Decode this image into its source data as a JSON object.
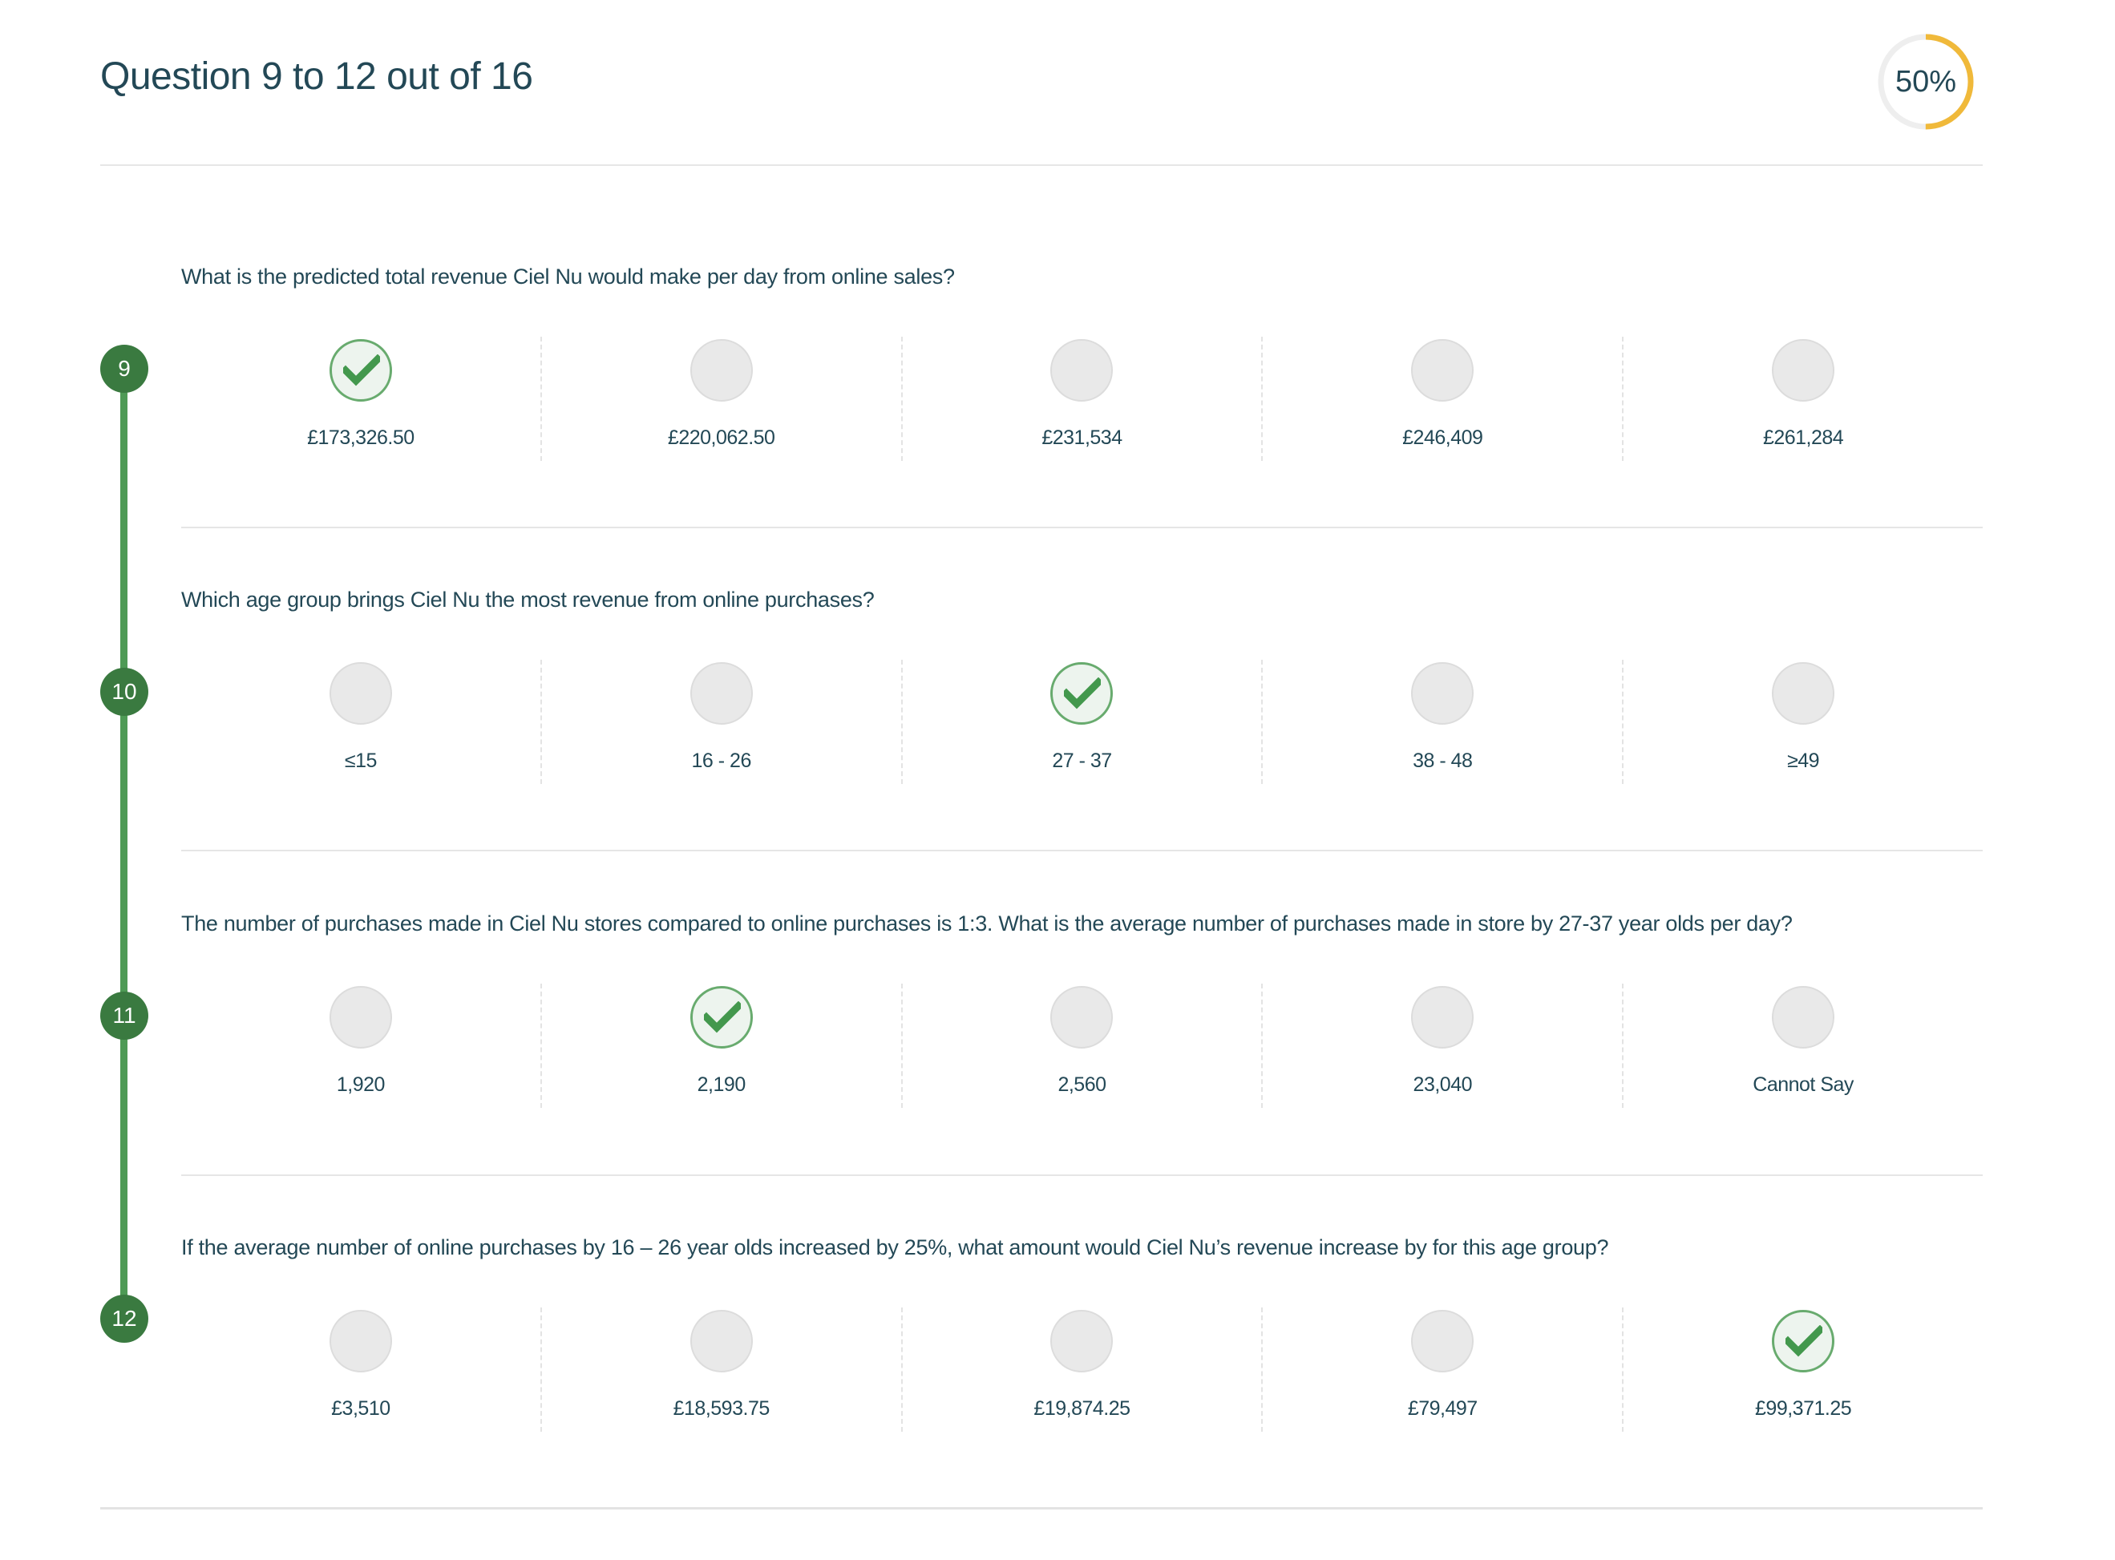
{
  "header": {
    "title": "Question 9 to 12 out of 16",
    "progress_label": "50%",
    "progress_fraction": 0.5,
    "progress_color": "#f0b93a",
    "progress_track_color": "#eeeeee"
  },
  "colors": {
    "accent_green": "#3a7a40",
    "timeline_green": "#4e9a55",
    "text": "#234856"
  },
  "questions": [
    {
      "number": "9",
      "text": "What is the predicted total revenue Ciel Nu would make per day from online sales?",
      "selected_index": 0,
      "options": [
        "£173,326.50",
        "£220,062.50",
        "£231,534",
        "£246,409",
        "£261,284"
      ]
    },
    {
      "number": "10",
      "text": "Which age group brings Ciel Nu the most revenue from online purchases?",
      "selected_index": 2,
      "options": [
        "≤15",
        "16 - 26",
        "27 - 37",
        "38 - 48",
        "≥49"
      ]
    },
    {
      "number": "11",
      "text": "The number of purchases made in Ciel Nu stores compared to online purchases is 1:3. What is the average number of purchases made in store by 27-37 year olds per day?",
      "selected_index": 1,
      "options": [
        "1,920",
        "2,190",
        "2,560",
        "23,040",
        "Cannot Say"
      ]
    },
    {
      "number": "12",
      "text": "If the average number of online purchases by 16 – 26 year olds increased by 25%, what amount would Ciel Nu’s revenue increase by for this age group?",
      "selected_index": 4,
      "options": [
        "£3,510",
        "£18,593.75",
        "£19,874.25",
        "£79,497",
        "£99,371.25"
      ]
    }
  ]
}
